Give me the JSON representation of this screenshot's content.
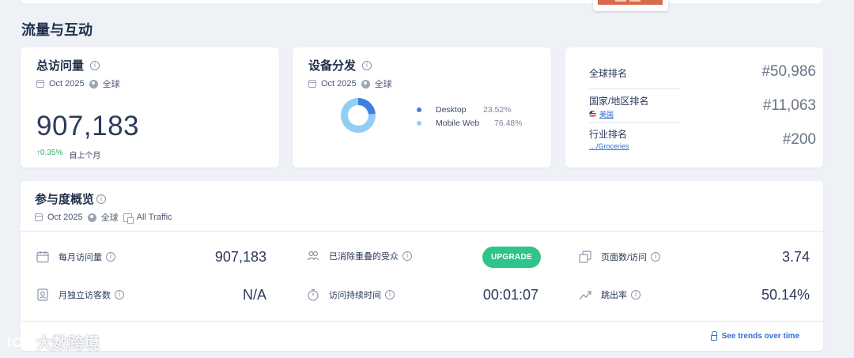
{
  "section_title": "流量与互动",
  "visits": {
    "title": "总访问量",
    "date": "Oct 2025",
    "region": "全球",
    "value": "907,183",
    "change": "↑0.35%",
    "change_label": "自上个月"
  },
  "device": {
    "title": "设备分发",
    "date": "Oct 2025",
    "region": "全球",
    "legend": [
      {
        "name": "Desktop",
        "value": "23.52%",
        "color": "#3f7ee0"
      },
      {
        "name": "Mobile Web",
        "value": "76.48%",
        "color": "#93cdf5"
      }
    ]
  },
  "chart_data": {
    "type": "pie",
    "categories": [
      "Desktop",
      "Mobile Web"
    ],
    "values": [
      23.52,
      76.48
    ],
    "colors": [
      "#3f7ee0",
      "#93cdf5"
    ]
  },
  "ranks": [
    {
      "label": "全球排名",
      "sub": "",
      "value": "#50,986"
    },
    {
      "label": "国家/地区排名",
      "sub": "美国",
      "value": "#11,063"
    },
    {
      "label": "行业排名",
      "sub": "…/Groceries",
      "value": "#200"
    }
  ],
  "engagement": {
    "title": "参与度概览",
    "date": "Oct 2025",
    "region": "全球",
    "traffic": "All Traffic",
    "metrics": {
      "monthly_visits": {
        "label": "每月访问量",
        "value": "907,183"
      },
      "unique_visitors": {
        "label": "月独立访客数",
        "value": "N/A"
      },
      "dedup_audience": {
        "label": "已消除重叠的受众"
      },
      "visit_duration": {
        "label": "访问持续时间",
        "value": "00:01:07"
      },
      "pages_per_visit": {
        "label": "页面数/访问",
        "value": "3.74"
      },
      "bounce_rate": {
        "label": "跳出率",
        "value": "50.14%"
      }
    },
    "upgrade_label": "UPGRADE",
    "trends_label": "See trends over time"
  },
  "watermark": "大数跨境"
}
